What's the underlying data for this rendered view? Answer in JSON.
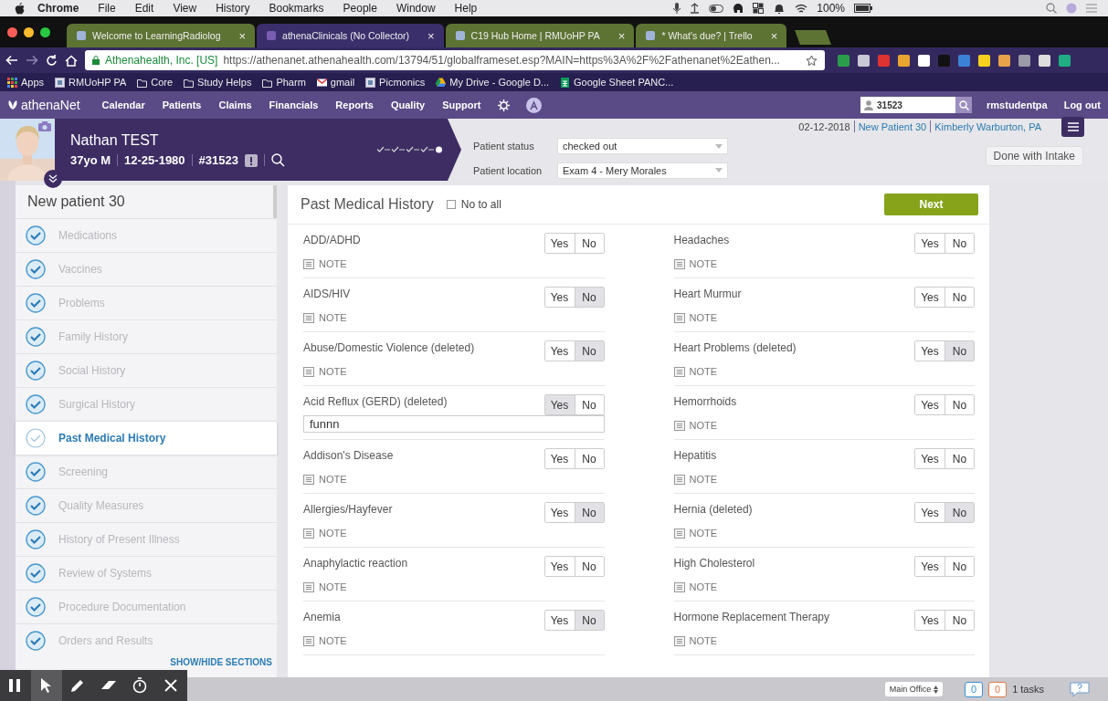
{
  "menu_bar": {
    "app": "Chrome",
    "items": [
      "File",
      "Edit",
      "View",
      "History",
      "Bookmarks",
      "People",
      "Window",
      "Help"
    ],
    "battery": "100%"
  },
  "browser_tabs": [
    {
      "title": "Welcome to LearningRadiolog",
      "close": "×",
      "selected": false
    },
    {
      "title": "athenaClinicals (No Collector)",
      "close": "×",
      "selected": true
    },
    {
      "title": "C19 Hub Home | RMUoHP PA",
      "close": "×",
      "selected": false
    },
    {
      "title": "* What's due? | Trello",
      "close": "×",
      "selected": false
    }
  ],
  "address_bar": {
    "site": "Athenahealth, Inc. [US]",
    "url": "https://athenanet.athenahealth.com/13794/51/globalframeset.esp?MAIN=https%3A%2F%2Fathenanet%2Eathen..."
  },
  "bookmarks": [
    {
      "kind": "apps",
      "label": "Apps"
    },
    {
      "kind": "page",
      "label": "RMUoHP PA"
    },
    {
      "kind": "folder",
      "label": "Core"
    },
    {
      "kind": "folder",
      "label": "Study Helps"
    },
    {
      "kind": "folder",
      "label": "Pharm"
    },
    {
      "kind": "mail",
      "label": "gmail"
    },
    {
      "kind": "page",
      "label": "Picmonics"
    },
    {
      "kind": "drive",
      "label": "My Drive - Google D..."
    },
    {
      "kind": "sheet",
      "label": "Google Sheet PANC..."
    }
  ],
  "app_nav": {
    "logo": "athenaNet",
    "items": [
      "Calendar",
      "Patients",
      "Claims",
      "Financials",
      "Reports",
      "Quality",
      "Support"
    ],
    "patient_search": "31523",
    "user": "rmstudentpa",
    "logout": "Log out"
  },
  "patient": {
    "name": "Nathan TEST",
    "age_sex": "37yo M",
    "dob": "12-25-1980",
    "id": "#31523",
    "status_label": "Patient status",
    "status": "checked out",
    "location_label": "Patient location",
    "location": "Exam 4 - Mery Morales",
    "date": "02-12-2018",
    "encounter": "New Patient 30",
    "provider": "Kimberly Warburton, PA",
    "done_button": "Done with Intake"
  },
  "progress_steps": [
    {
      "done": true
    },
    {
      "done": true
    },
    {
      "done": true
    },
    {
      "done": true
    },
    {
      "done": false
    }
  ],
  "sidebar": {
    "title": "New patient 30",
    "footer": "SHOW/HIDE SECTIONS",
    "items": [
      {
        "label": "Medications",
        "completed": true,
        "selected": false
      },
      {
        "label": "Vaccines",
        "completed": true,
        "selected": false
      },
      {
        "label": "Problems",
        "completed": true,
        "selected": false
      },
      {
        "label": "Family History",
        "completed": true,
        "selected": false
      },
      {
        "label": "Social History",
        "completed": true,
        "selected": false
      },
      {
        "label": "Surgical History",
        "completed": true,
        "selected": false
      },
      {
        "label": "Past Medical History",
        "completed": false,
        "selected": true
      },
      {
        "label": "Screening",
        "completed": true,
        "selected": false
      },
      {
        "label": "Quality Measures",
        "completed": true,
        "selected": false
      },
      {
        "label": "History of Present Illness",
        "completed": true,
        "selected": false
      },
      {
        "label": "Review of Systems",
        "completed": true,
        "selected": false
      },
      {
        "label": "Procedure Documentation",
        "completed": true,
        "selected": false
      },
      {
        "label": "Orders and Results",
        "completed": true,
        "selected": false
      }
    ]
  },
  "section": {
    "title": "Past Medical History",
    "no_to_all": {
      "label": "No to all",
      "checked": false
    },
    "next": "Next",
    "columns": [
      [
        {
          "condition": "ADD/ADHD",
          "answers": [
            {
              "label": "Yes",
              "selected": false
            },
            {
              "label": "No",
              "selected": false
            }
          ],
          "note": {
            "kind": "link",
            "label": "NOTE"
          }
        },
        {
          "condition": "AIDS/HIV",
          "answers": [
            {
              "label": "Yes",
              "selected": false
            },
            {
              "label": "No",
              "selected": true
            }
          ],
          "note": {
            "kind": "link",
            "label": "NOTE"
          }
        },
        {
          "condition": "Abuse/Domestic Violence (deleted)",
          "answers": [
            {
              "label": "Yes",
              "selected": false
            },
            {
              "label": "No",
              "selected": true
            }
          ],
          "note": {
            "kind": "link",
            "label": "NOTE"
          }
        },
        {
          "condition": "Acid Reflux (GERD) (deleted)",
          "answers": [
            {
              "label": "Yes",
              "selected": true
            },
            {
              "label": "No",
              "selected": false
            }
          ],
          "note": {
            "kind": "field",
            "value": "funnn"
          }
        },
        {
          "condition": "Addison's Disease",
          "answers": [
            {
              "label": "Yes",
              "selected": false
            },
            {
              "label": "No",
              "selected": false
            }
          ],
          "note": {
            "kind": "link",
            "label": "NOTE"
          }
        },
        {
          "condition": "Allergies/Hayfever",
          "answers": [
            {
              "label": "Yes",
              "selected": false
            },
            {
              "label": "No",
              "selected": true
            }
          ],
          "note": {
            "kind": "link",
            "label": "NOTE"
          }
        },
        {
          "condition": "Anaphylactic reaction",
          "answers": [
            {
              "label": "Yes",
              "selected": false
            },
            {
              "label": "No",
              "selected": false
            }
          ],
          "note": {
            "kind": "link",
            "label": "NOTE"
          }
        },
        {
          "condition": "Anemia",
          "answers": [
            {
              "label": "Yes",
              "selected": false
            },
            {
              "label": "No",
              "selected": true
            }
          ],
          "note": {
            "kind": "link",
            "label": "NOTE"
          }
        }
      ],
      [
        {
          "condition": "Headaches",
          "answers": [
            {
              "label": "Yes",
              "selected": false
            },
            {
              "label": "No",
              "selected": false
            }
          ],
          "note": {
            "kind": "link",
            "label": "NOTE"
          }
        },
        {
          "condition": "Heart Murmur",
          "answers": [
            {
              "label": "Yes",
              "selected": false
            },
            {
              "label": "No",
              "selected": false
            }
          ],
          "note": {
            "kind": "link",
            "label": "NOTE"
          }
        },
        {
          "condition": "Heart Problems (deleted)",
          "answers": [
            {
              "label": "Yes",
              "selected": false
            },
            {
              "label": "No",
              "selected": true
            }
          ],
          "note": {
            "kind": "link",
            "label": "NOTE"
          }
        },
        {
          "condition": "Hemorrhoids",
          "answers": [
            {
              "label": "Yes",
              "selected": false
            },
            {
              "label": "No",
              "selected": false
            }
          ],
          "note": {
            "kind": "link",
            "label": "NOTE"
          }
        },
        {
          "condition": "Hepatitis",
          "answers": [
            {
              "label": "Yes",
              "selected": false
            },
            {
              "label": "No",
              "selected": false
            }
          ],
          "note": {
            "kind": "link",
            "label": "NOTE"
          }
        },
        {
          "condition": "Hernia (deleted)",
          "answers": [
            {
              "label": "Yes",
              "selected": false
            },
            {
              "label": "No",
              "selected": true
            }
          ],
          "note": {
            "kind": "link",
            "label": "NOTE"
          }
        },
        {
          "condition": "High Cholesterol",
          "answers": [
            {
              "label": "Yes",
              "selected": false
            },
            {
              "label": "No",
              "selected": false
            }
          ],
          "note": {
            "kind": "link",
            "label": "NOTE"
          }
        },
        {
          "condition": "Hormone Replacement Therapy",
          "answers": [
            {
              "label": "Yes",
              "selected": false
            },
            {
              "label": "No",
              "selected": false
            }
          ],
          "note": {
            "kind": "link",
            "label": "NOTE"
          }
        }
      ]
    ]
  },
  "status_bar": {
    "office": "Main Office",
    "counts": [
      {
        "value": "0",
        "color": "#3a8fd0"
      },
      {
        "value": "0",
        "color": "#e07a4a"
      }
    ],
    "tasks": "1 tasks"
  },
  "recording_toolbar": {
    "tools": [
      {
        "kind": "pause",
        "selected": false
      },
      {
        "kind": "pointer",
        "selected": true
      },
      {
        "kind": "pen",
        "selected": false
      },
      {
        "kind": "eraser",
        "selected": false
      },
      {
        "kind": "timer",
        "selected": false
      },
      {
        "kind": "close",
        "selected": false
      }
    ]
  }
}
